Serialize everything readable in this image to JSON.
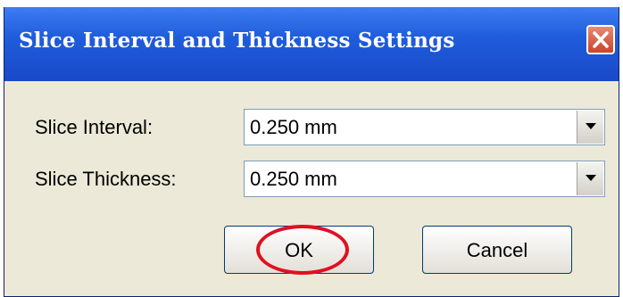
{
  "dialog": {
    "title": "Slice Interval and Thickness Settings",
    "close_icon": "close-icon"
  },
  "fields": {
    "interval": {
      "label": "Slice Interval:",
      "value": "0.250 mm"
    },
    "thickness": {
      "label": "Slice Thickness:",
      "value": "0.250 mm"
    }
  },
  "buttons": {
    "ok_label": "OK",
    "cancel_label": "Cancel"
  },
  "highlight_color": "#e01020"
}
